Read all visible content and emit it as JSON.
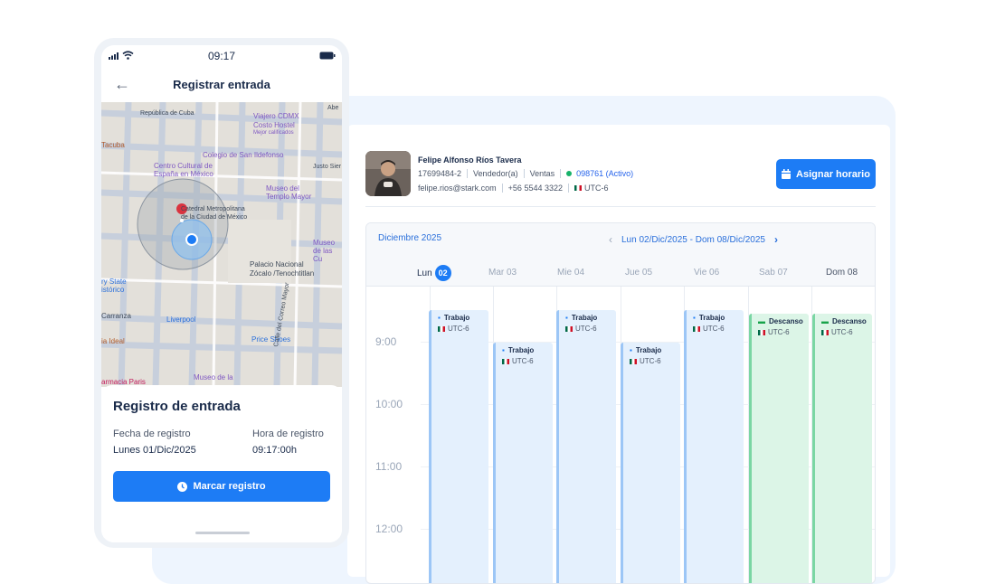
{
  "colors": {
    "accent": "#1d7cf5",
    "work_event": "#e4f0fd",
    "rest_event": "#dcf5e7",
    "active_status": "#17b26a"
  },
  "phone": {
    "status_time": "09:17",
    "header_title": "Registrar entrada",
    "map_labels": {
      "cuba": "República de Cuba",
      "viajero": "Viajero CDMX",
      "costo": "Costo Hostel",
      "mejor": "Mejor calificados",
      "abe": "Abe",
      "tacuba": "Tacuba",
      "colegio": "Colegio de San Ildefonso",
      "centro": "Centro Cultural de",
      "espana": "España en México",
      "justo": "Justo Sier",
      "museo_templo": "Museo del",
      "templo": "Templo Mayor",
      "catedral": "Catedral Metropolitana",
      "ciudad": "de la Ciudad de México",
      "museo_las": "Museo de las Cu",
      "palacio": "Palacio Nacional",
      "zocalo": "Zócalo /Tenochtitlan",
      "ry": "ry State",
      "istorico": "istórico",
      "carranza": "Carranza",
      "liverpool": "Liverpool",
      "price": "Price Shoes",
      "ideal": "ia Ideal",
      "museo_la": "Museo de la",
      "farmacia": "armacia Paris",
      "correo": "Calle del Correo Mayor"
    },
    "sheet": {
      "title": "Registro de entrada",
      "date_label": "Fecha de registro",
      "date_value": "Lunes 01/Dic/2025",
      "time_label": "Hora de registro",
      "time_value": "09:17:00h",
      "button": "Marcar registro"
    }
  },
  "employee": {
    "name": "Felipe Alfonso Ríos Tavera",
    "id": "17699484-2",
    "role": "Vendedor(a)",
    "dept": "Ventas",
    "code": "098761 (Activo)",
    "email": "felipe.rios@stark.com",
    "phone": "+56 5544 3322",
    "tz": "UTC-6"
  },
  "assign_button": "Asignar horario",
  "calendar": {
    "month": "Diciembre 2025",
    "range": "Lun 02/Dic/2025 - Dom 08/Dic/2025",
    "days": [
      {
        "label": "Lun",
        "num": "02"
      },
      {
        "label": "Mar 03",
        "num": ""
      },
      {
        "label": "Mie 04",
        "num": ""
      },
      {
        "label": "Jue 05",
        "num": ""
      },
      {
        "label": "Vie 06",
        "num": ""
      },
      {
        "label": "Sab",
        "num": "07"
      },
      {
        "label": "Dom 08",
        "num": ""
      }
    ],
    "times": [
      "9:00",
      "10:00",
      "11:00",
      "12:00"
    ],
    "events": [
      {
        "title": "Trabajo",
        "tz": "UTC-6"
      },
      {
        "title": "Trabajo",
        "tz": "UTC-6"
      },
      {
        "title": "Trabajo",
        "tz": "UTC-6"
      },
      {
        "title": "Trabajo",
        "tz": "UTC-6"
      },
      {
        "title": "Trabajo",
        "tz": "UTC-6"
      },
      {
        "title": "Descanso",
        "tz": "UTC-6"
      },
      {
        "title": "Descanso",
        "tz": "UTC-6"
      }
    ]
  }
}
